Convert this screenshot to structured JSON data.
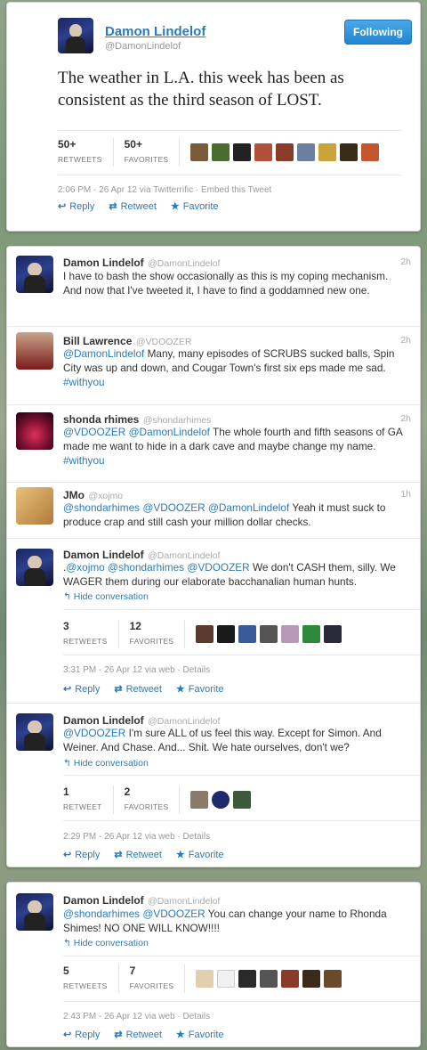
{
  "embed": {
    "name": "Damon Lindelof",
    "handle": "@DamonLindelof",
    "follow_label": "Following",
    "text": "The weather in L.A. this week has been as consistent as the third season of LOST.",
    "retweets": "50+",
    "retweets_label": "RETWEETS",
    "favorites": "50+",
    "favorites_label": "FAVORITES",
    "meta": "2:06 PM - 26 Apr 12 via Twitterrific · Embed this Tweet",
    "reply": "Reply",
    "retweet": "Retweet",
    "favorite": "Favorite"
  },
  "tweets": [
    {
      "name": "Damon Lindelof",
      "handle": "@DamonLindelof",
      "time": "2h",
      "text": "I have to bash the show occasionally as this is my coping mechanism. And now that I've tweeted it, I have to find a goddamned new one."
    },
    {
      "name": "Bill Lawrence",
      "handle": "@VDOOZER",
      "time": "2h",
      "mention": "@DamonLindelof",
      "text": " Many, many episodes of SCRUBS sucked balls, Spin City was up and down, and Cougar Town's first six eps made me sad. ",
      "tag": "#withyou"
    },
    {
      "name": "shonda rhimes",
      "handle": "@shondarhimes",
      "time": "2h",
      "mention": "@VDOOZER @DamonLindelof",
      "text": " The whole fourth and fifth seasons of GA made me want to hide in a dark cave and maybe change my name. ",
      "tag": "#withyou"
    },
    {
      "name": "JMo",
      "handle": "@xojmo",
      "time": "1h",
      "mention": "@shondarhimes @VDOOZER @DamonLindelof",
      "text": " Yeah it must suck to produce crap and still cash your million dollar checks."
    },
    {
      "name": "Damon Lindelof",
      "handle": "@DamonLindelof",
      "mention_pre": ".",
      "mention": "@xojmo @shondarhimes @VDOOZER",
      "text": " We don't CASH them, silly. We WAGER them during our elaborate bacchanalian human hunts.",
      "hide": "Hide conversation",
      "retweets": "3",
      "retweets_label": "RETWEETS",
      "favorites": "12",
      "favorites_label": "FAVORITES",
      "meta": "3:31 PM - 26 Apr 12 via web · Details"
    },
    {
      "name": "Damon Lindelof",
      "handle": "@DamonLindelof",
      "mention": "@VDOOZER",
      "text": " I'm sure ALL of us feel this way. Except for Simon. And Weiner. And Chase. And... Shit. We hate ourselves, don't we?",
      "hide": "Hide conversation",
      "retweets": "1",
      "retweets_label": "RETWEET",
      "favorites": "2",
      "favorites_label": "FAVORITES",
      "meta": "2:29 PM - 26 Apr 12 via web · Details"
    },
    {
      "name": "Damon Lindelof",
      "handle": "@DamonLindelof",
      "mention": "@shondarhimes @VDOOZER",
      "text": " You can change your name to Rhonda Shimes! NO ONE WILL KNOW!!!!",
      "hide": "Hide conversation",
      "retweets": "5",
      "retweets_label": "RETWEETS",
      "favorites": "7",
      "favorites_label": "FAVORITES",
      "meta": "2:43 PM - 26 Apr 12 via web · Details"
    }
  ],
  "actions": {
    "reply": "Reply",
    "retweet": "Retweet",
    "favorite": "Favorite"
  },
  "colors": {
    "link": "#2a7bbd",
    "follow": "#2385cf"
  }
}
